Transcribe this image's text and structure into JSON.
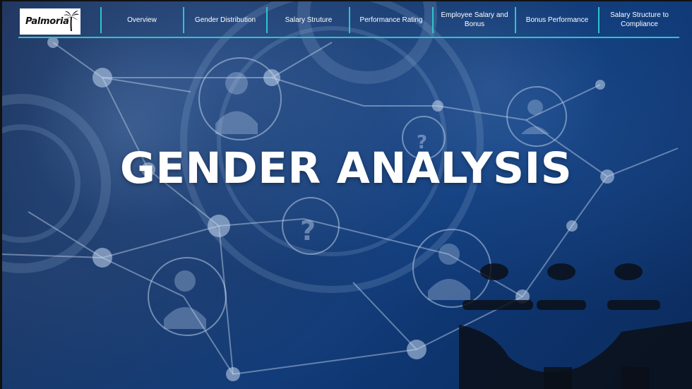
{
  "logo": {
    "text": "Palmoria"
  },
  "nav": {
    "items": [
      {
        "label": "Overview"
      },
      {
        "label": "Gender Distribution"
      },
      {
        "label": "Salary Struture"
      },
      {
        "label": "Performance Rating"
      },
      {
        "label": "Employee Salary and Bonus"
      },
      {
        "label": "Bonus Performance"
      },
      {
        "label": "Salary Structure to Compliance"
      }
    ]
  },
  "main": {
    "title": "GENDER ANALYSIS"
  },
  "colors": {
    "accent": "#2ec4c9",
    "title": "#ffffff",
    "background": "#0f3a78"
  }
}
